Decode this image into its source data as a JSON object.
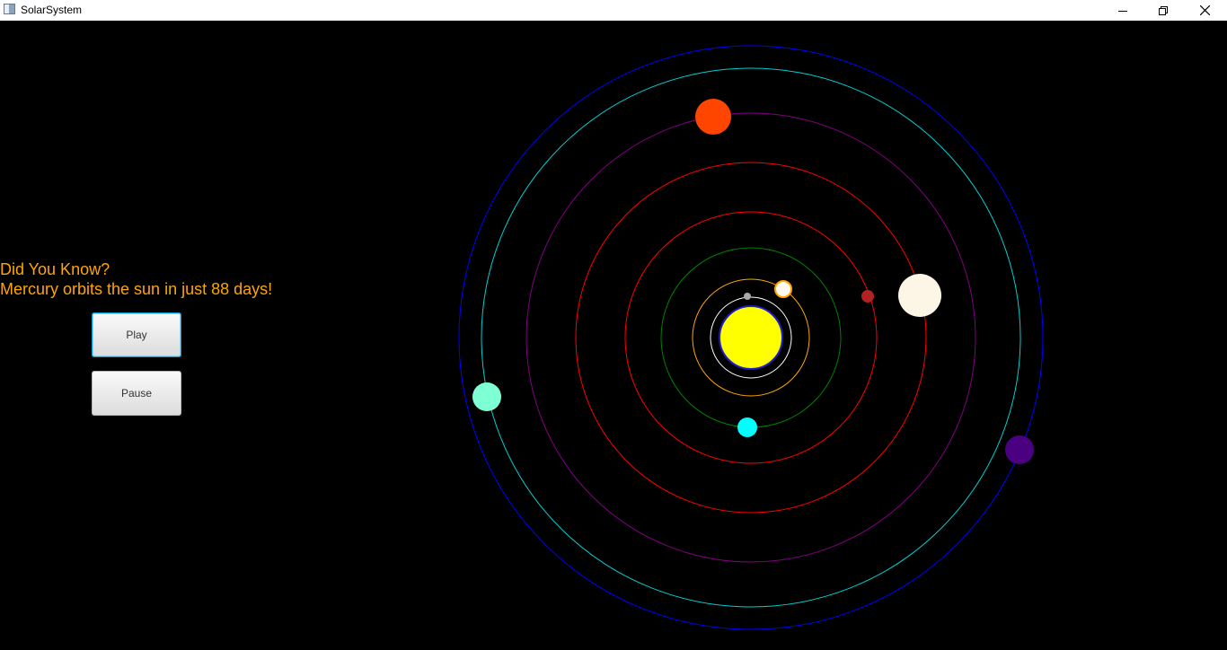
{
  "window": {
    "title": "SolarSystem",
    "controls": [
      "minimize-icon",
      "restore-icon",
      "close-icon"
    ]
  },
  "fact": {
    "heading": "Did You Know?",
    "text": "Mercury orbits the sun in just 88 days!",
    "color": "#ffa500"
  },
  "buttons": {
    "play_label": "Play",
    "pause_label": "Pause"
  },
  "colors": {
    "background": "#000000",
    "sun": "#ffff00"
  },
  "orbits": [
    {
      "name": "mercury-orbit",
      "color": "#ffffff"
    },
    {
      "name": "venus-orbit",
      "color": "#ffa500"
    },
    {
      "name": "earth-orbit",
      "color": "#008000"
    },
    {
      "name": "mars-orbit",
      "color": "#ff0000"
    },
    {
      "name": "jupiter-orbit",
      "color": "#ff0000"
    },
    {
      "name": "saturn-orbit",
      "color": "#800080"
    },
    {
      "name": "uranus-orbit",
      "color": "#00ced1"
    },
    {
      "name": "neptune-orbit",
      "color": "#0000ff"
    }
  ],
  "planets": [
    {
      "name": "mercury",
      "color": "#a9a9a9"
    },
    {
      "name": "venus",
      "color": "#fffaf0"
    },
    {
      "name": "earth",
      "color": "#00ffff"
    },
    {
      "name": "mars",
      "color": "#b22222"
    },
    {
      "name": "jupiter",
      "color": "#fdf5e6"
    },
    {
      "name": "saturn",
      "color": "#ff4500"
    },
    {
      "name": "uranus",
      "color": "#7fffd4"
    },
    {
      "name": "neptune",
      "color": "#4b0082"
    }
  ]
}
